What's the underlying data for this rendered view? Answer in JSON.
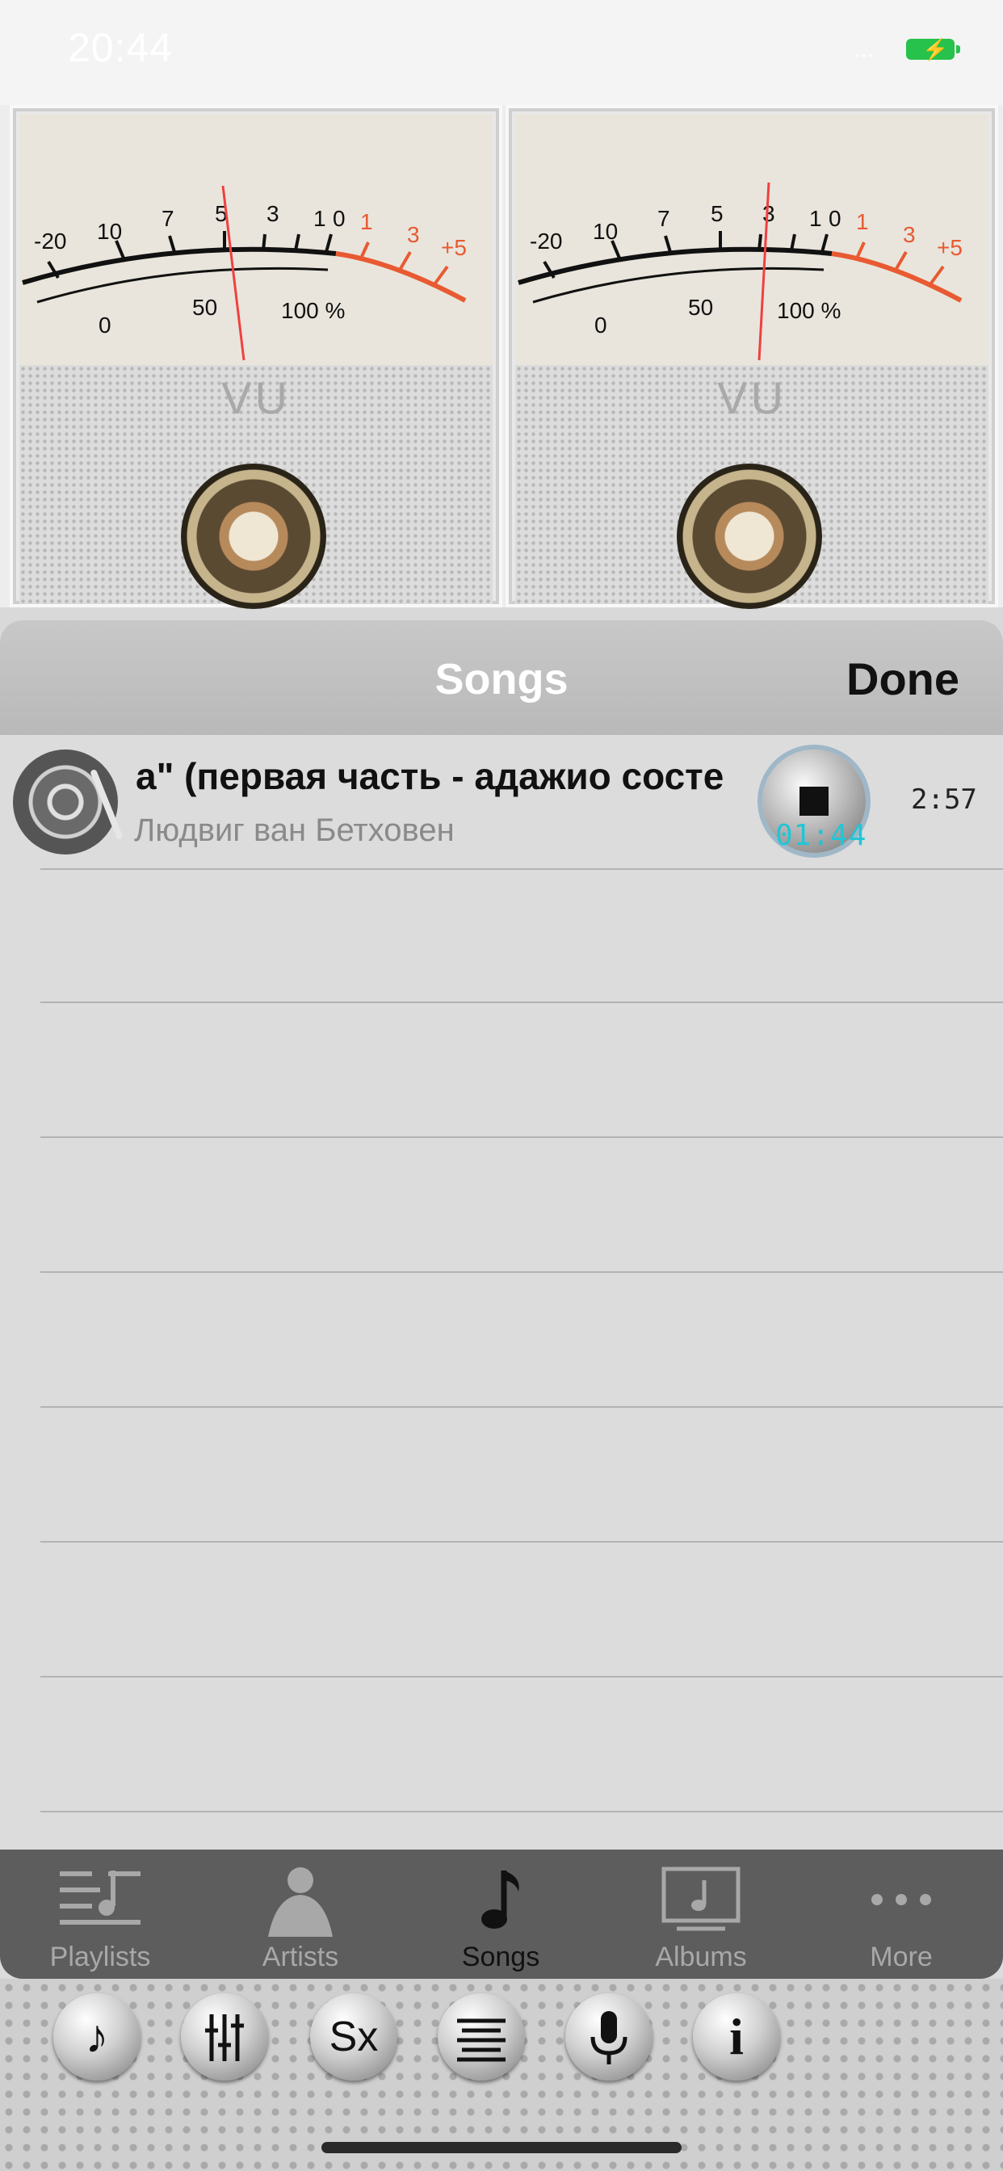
{
  "status_bar": {
    "time": "20:44"
  },
  "meters": {
    "scale_black": [
      "-20",
      "10",
      "7",
      "5",
      "3",
      "1",
      "0"
    ],
    "scale_red": [
      "1",
      "3",
      "+5"
    ],
    "scale_percent": [
      "0",
      "50",
      "100 %"
    ],
    "label": "VU"
  },
  "sheet": {
    "title": "Songs",
    "done": "Done"
  },
  "songs": [
    {
      "title": "а\" (первая часть - адажио состе",
      "artist": "Людвиг ван Бетховен",
      "elapsed": "01:44",
      "duration": "2:57"
    }
  ],
  "tabs": [
    {
      "label": "Playlists",
      "icon": "playlists-icon"
    },
    {
      "label": "Artists",
      "icon": "artist-icon"
    },
    {
      "label": "Songs",
      "icon": "music-note-icon",
      "active": true
    },
    {
      "label": "Albums",
      "icon": "albums-icon"
    },
    {
      "label": "More",
      "icon": "more-icon"
    }
  ],
  "bottom_buttons": [
    {
      "name": "music-note-button",
      "glyph": "♪"
    },
    {
      "name": "equalizer-button",
      "glyph": ""
    },
    {
      "name": "sx-button",
      "glyph": "Sx"
    },
    {
      "name": "list-button",
      "glyph": ""
    },
    {
      "name": "microphone-button",
      "glyph": ""
    },
    {
      "name": "info-button",
      "glyph": "i"
    }
  ],
  "colors": {
    "accent_red": "#e85a32",
    "display_cyan": "#20c6d6",
    "battery_green": "#27c24c"
  }
}
